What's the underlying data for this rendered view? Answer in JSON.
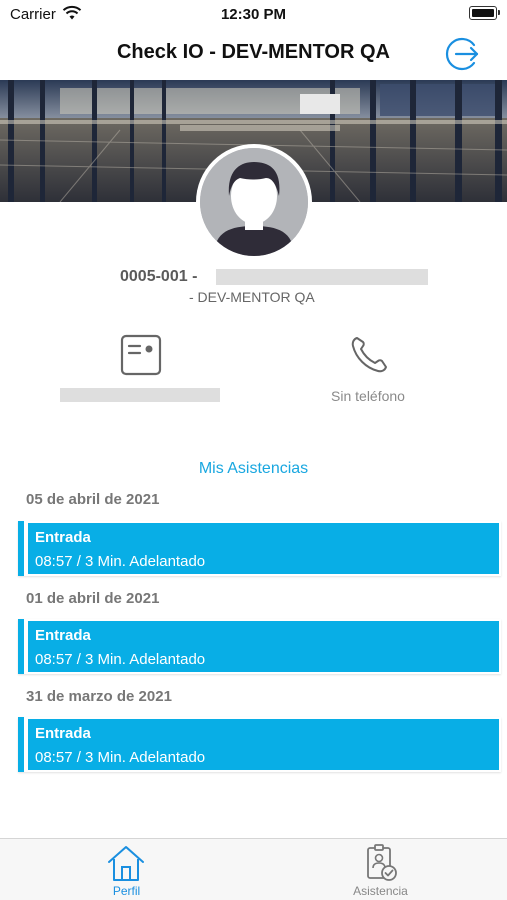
{
  "status_bar": {
    "carrier": "Carrier",
    "time": "12:30 PM"
  },
  "nav": {
    "title": "Check IO - DEV-MENTOR QA",
    "logout_icon": "logout-icon"
  },
  "profile": {
    "code": "0005-001 -",
    "company": "- DEV-MENTOR QA"
  },
  "info": {
    "phone_label": "Sin teléfono",
    "id_icon": "id-card-icon",
    "phone_icon": "phone-icon"
  },
  "attendance": {
    "title": "Mis Asistencias",
    "days": [
      {
        "date": "05 de abril de  2021",
        "records": [
          {
            "type": "Entrada",
            "detail": "08:57 / 3 Min. Adelantado"
          }
        ]
      },
      {
        "date": "01 de abril de  2021",
        "records": [
          {
            "type": "Entrada",
            "detail": "08:57 / 3 Min. Adelantado"
          }
        ]
      },
      {
        "date": "31 de marzo de  2021",
        "records": [
          {
            "type": "Entrada",
            "detail": "08:57 / 3 Min. Adelantado"
          }
        ]
      }
    ]
  },
  "tabs": [
    {
      "label": "Perfil",
      "icon": "home-icon",
      "selected": true
    },
    {
      "label": "Asistencia",
      "icon": "badge-check-icon",
      "selected": false
    }
  ],
  "colors": {
    "accent": "#08aee6",
    "title_accent": "#19a7e0",
    "tab_active": "#1a8fe0"
  }
}
